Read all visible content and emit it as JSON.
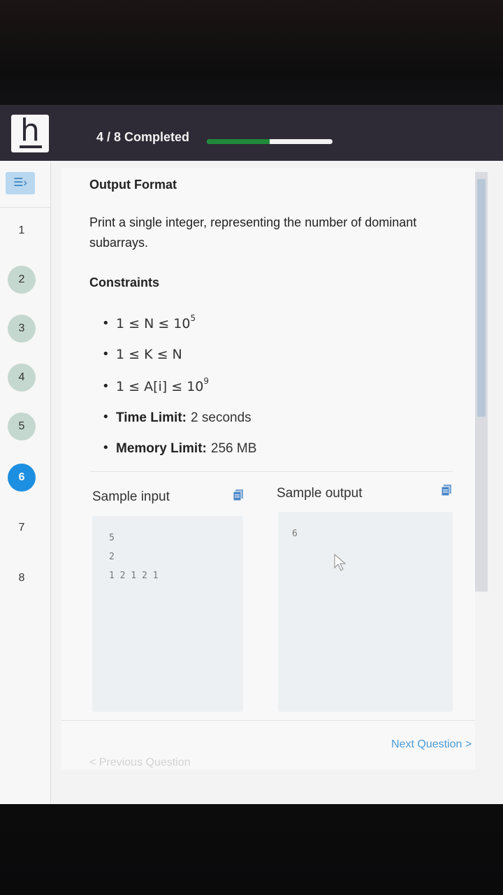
{
  "header": {
    "logo_letter": "h",
    "progress_text": "4 / 8 Completed",
    "progress_fraction": 0.5
  },
  "sidebar": {
    "menu_icon": "collapse-menu-icon",
    "questions": [
      {
        "number": "1",
        "state": "default"
      },
      {
        "number": "2",
        "state": "done"
      },
      {
        "number": "3",
        "state": "done"
      },
      {
        "number": "4",
        "state": "done"
      },
      {
        "number": "5",
        "state": "done"
      },
      {
        "number": "6",
        "state": "current"
      },
      {
        "number": "7",
        "state": "default"
      },
      {
        "number": "8",
        "state": "default"
      }
    ]
  },
  "content": {
    "output_format_title": "Output Format",
    "output_format_text": "Print a single integer, representing the number of dominant subarrays.",
    "constraints_title": "Constraints",
    "constraints": {
      "n_range_prefix": "1 ≤ N ≤ 10",
      "n_range_exp": "5",
      "k_range": "1 ≤ K ≤ N",
      "a_range_prefix": "1 ≤ A[i] ≤ 10",
      "a_range_exp": "9",
      "time_label": "Time Limit:",
      "time_value": "2 seconds",
      "memory_label": "Memory Limit:",
      "memory_value": "256 MB"
    },
    "sample_input_title": "Sample input",
    "sample_input_lines": [
      "5",
      "2",
      "1 2 1 2 1"
    ],
    "sample_output_title": "Sample output",
    "sample_output_lines": [
      "6"
    ]
  },
  "footer": {
    "previous_label": "< Previous Question",
    "next_label": "Next Question >"
  },
  "colors": {
    "topbar": "#2f2b36",
    "progress_fill": "#1f8a3a",
    "current_question": "#1d8fe0",
    "done_question": "#c5d8cf",
    "link": "#4a9bd6"
  }
}
